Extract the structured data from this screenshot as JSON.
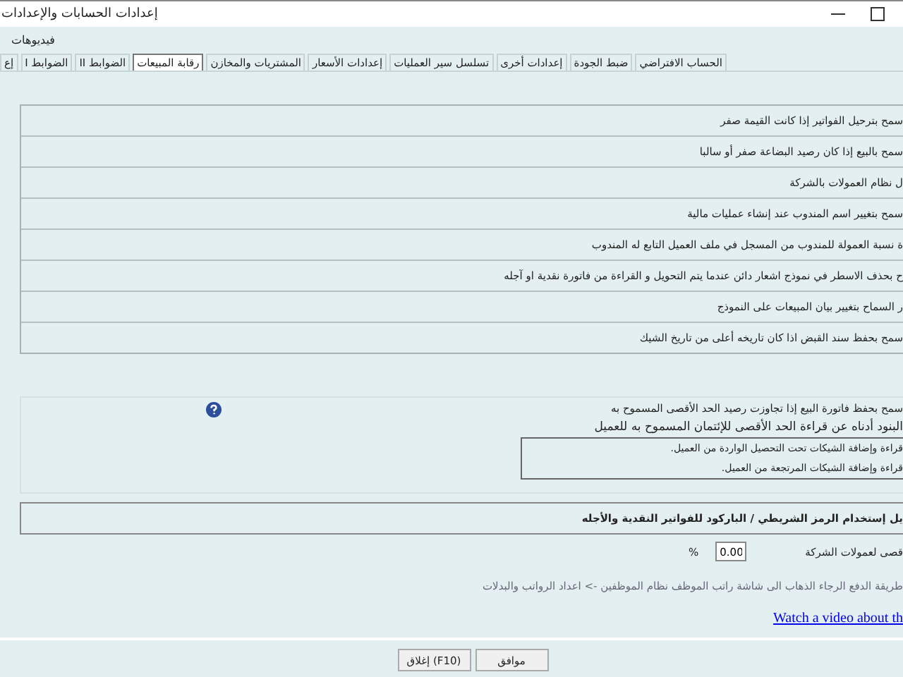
{
  "window": {
    "title": "إعدادات الحسابات والإعدادات"
  },
  "menu": [
    "فيديوهات"
  ],
  "tabs": [
    {
      "label": "الحساب الافتراضي",
      "selected": false
    },
    {
      "label": "ضبط الجودة",
      "selected": false
    },
    {
      "label": "إعدادات أخرى",
      "selected": false
    },
    {
      "label": "تسلسل سير العمليات",
      "selected": false
    },
    {
      "label": "إعدادات الأسعار",
      "selected": false
    },
    {
      "label": "المشتريات والمخازن",
      "selected": false
    },
    {
      "label": "رقابة المبيعات",
      "selected": true
    },
    {
      "label": "الضوابط II",
      "selected": false
    },
    {
      "label": "الضوابط I",
      "selected": false
    },
    {
      "label": "إع",
      "selected": false
    }
  ],
  "options": [
    "سمح بترحيل الفواتير إذا كانت القيمة صفر",
    "سمح بالبيع إذا كان رصيد البضاعة صفر أو سالبا",
    "ل نظام العمولات بالشركة",
    "سمح بتغيير اسم المندوب عند إنشاء عمليات مالية",
    "ة نسبة العمولة للمندوب من المسجل في ملف العميل التابع له المندوب",
    "ح بحذف الاسطر في نموذج اشعار دائن عندما يتم التحويل و القراءة من فاتورة نقدية او آجله",
    "ر السماح بتغيير بيان المبيعات على النموذج",
    "سمح بحفظ سند القبض اذا كان تاريخه أعلى من تاريخ الشيك"
  ],
  "credit_limit": {
    "option": "سمح بحفظ فاتورة البيع إذا تجاوزت رصيد الحد الأقصى المسموح به",
    "heading": "البنود أدناه عن قراءة الحد الأقصى للإئتمان المسموح به للعميل",
    "items": [
      "قراءة وإضافة الشيكات تحت التحصيل الواردة من العميل.",
      "قراءة وإضافة الشيكات المرتجعة من العميل."
    ]
  },
  "barcode_option": "يل إستخدام الرمز الشريطي / الباركود للفواتير النقدية والأجله",
  "commission": {
    "label": "قصى لعمولات الشركة",
    "value": "0.00",
    "unit": "%"
  },
  "note": "طريقة الدفع الرجاء الذهاب الى شاشة راتب الموظف نظام الموظفين -> اعداد الرواتب والبدلات",
  "video_link": "Watch a video about th",
  "buttons": [
    "موافق",
    "إغلاق (F10)"
  ]
}
